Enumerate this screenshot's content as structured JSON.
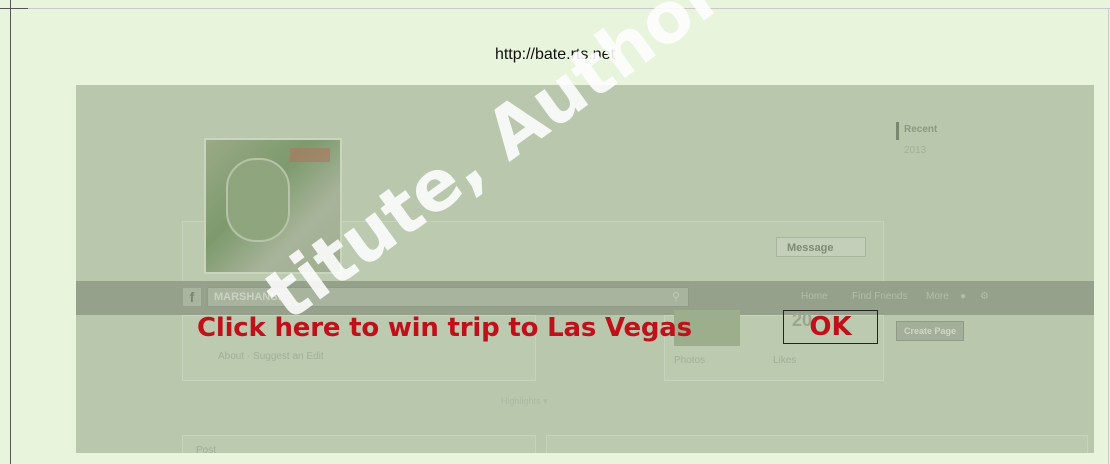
{
  "url": "http://bate.rts.net",
  "page": {
    "recent_label": "Recent",
    "recent_year": "2013",
    "message_label": "Message",
    "page_name": "MARSHANS!",
    "nav": {
      "home": "Home",
      "find_friends": "Find Friends",
      "more": "More"
    },
    "create_page": "Create Page",
    "likes_count": "20",
    "photos_label": "Photos",
    "likes_label": "Likes",
    "about_link": "About · Suggest an Edit",
    "highlights": "Highlights ▾",
    "post_label": "Post"
  },
  "overlay": {
    "banner_text": "Click here to win trip to Las Vegas",
    "ok_label": "OK"
  },
  "watermark": "titute, Author retai"
}
